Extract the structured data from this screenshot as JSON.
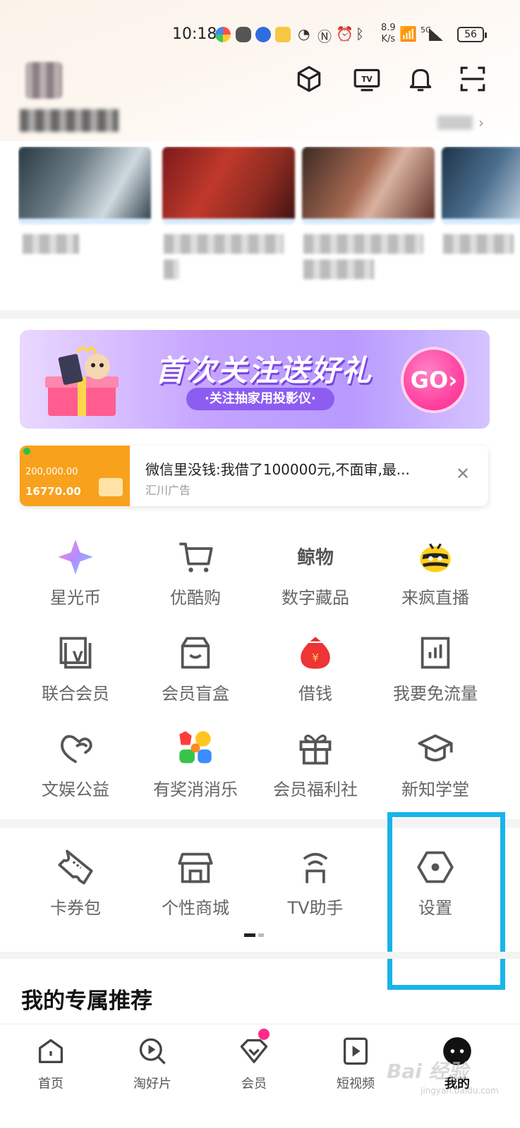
{
  "status_bar": {
    "time": "10:18",
    "speed_value": "8.9",
    "speed_unit": "K/s",
    "network": "5G",
    "battery": "56"
  },
  "header": {
    "icons": [
      "cube-icon",
      "tv-icon",
      "bell-icon",
      "scan-icon"
    ]
  },
  "history": {
    "title": "",
    "more": ""
  },
  "banner": {
    "title": "首次关注送好礼",
    "subtitle": "·关注抽家用投影仪·",
    "go": "GO›"
  },
  "ad": {
    "title": "微信里没钱:我借了100000元,不面审,最...",
    "source": "汇川广告",
    "close": "✕",
    "amount_1": "200,000.00",
    "amount_2": "16770.00"
  },
  "grid": [
    {
      "label": "星光币",
      "icon": "star-coin-icon"
    },
    {
      "label": "优酷购",
      "icon": "cart-icon"
    },
    {
      "label": "数字藏品",
      "icon": "digital-collection-icon"
    },
    {
      "label": "来疯直播",
      "icon": "bee-icon"
    },
    {
      "label": "联合会员",
      "icon": "joint-vip-icon"
    },
    {
      "label": "会员盲盒",
      "icon": "blind-box-icon"
    },
    {
      "label": "借钱",
      "icon": "money-bag-icon"
    },
    {
      "label": "我要免流量",
      "icon": "free-data-icon"
    },
    {
      "label": "文娱公益",
      "icon": "charity-icon"
    },
    {
      "label": "有奖消消乐",
      "icon": "candy-game-icon"
    },
    {
      "label": "会员福利社",
      "icon": "gift-icon"
    },
    {
      "label": "新知学堂",
      "icon": "graduation-cap-icon"
    },
    {
      "label": "卡券包",
      "icon": "ticket-icon"
    },
    {
      "label": "个性商城",
      "icon": "shop-icon"
    },
    {
      "label": "TV助手",
      "icon": "tv-assistant-icon"
    },
    {
      "label": "设置",
      "icon": "settings-hexagon-icon"
    }
  ],
  "recommend": {
    "title": "我的专属推荐"
  },
  "tabs": [
    {
      "label": "首页",
      "icon": "home-icon"
    },
    {
      "label": "淘好片",
      "icon": "explore-icon"
    },
    {
      "label": "会员",
      "icon": "vip-icon"
    },
    {
      "label": "短视频",
      "icon": "short-video-icon"
    },
    {
      "label": "我的",
      "icon": "profile-icon"
    }
  ],
  "watermark": {
    "text": "Bai 经验",
    "sub": "jingyan.baidu.com"
  },
  "colors": {
    "highlight": "#18b4ea",
    "banner_accent": "#8d5df2",
    "go_button": "#ff3b9c",
    "ad_orange": "#f8a11c"
  }
}
